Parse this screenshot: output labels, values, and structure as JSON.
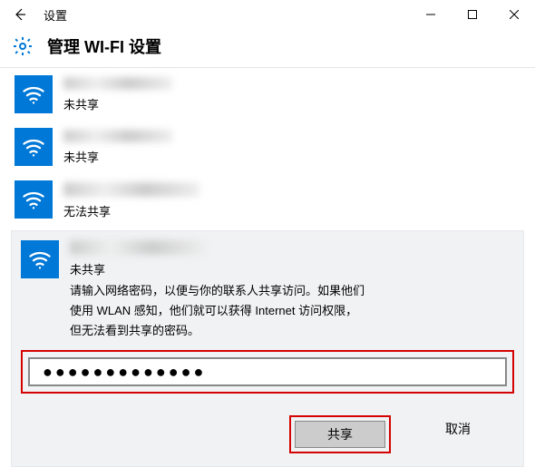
{
  "window": {
    "title": "设置"
  },
  "header": {
    "title": "管理 WI-FI 设置"
  },
  "networks": [
    {
      "status": "未共享"
    },
    {
      "status": "未共享"
    },
    {
      "status": "无法共享"
    }
  ],
  "selected": {
    "status": "未共享",
    "description_line1": "请输入网络密码，以便与你的联系人共享访问。如果他们",
    "description_line2": "使用 WLAN 感知，他们就可以获得 Internet 访问权限，",
    "description_line3": "但无法看到共享的密码。",
    "password_masked": "●●●●●●●●●●●●●"
  },
  "buttons": {
    "share": "共享",
    "cancel": "取消"
  }
}
